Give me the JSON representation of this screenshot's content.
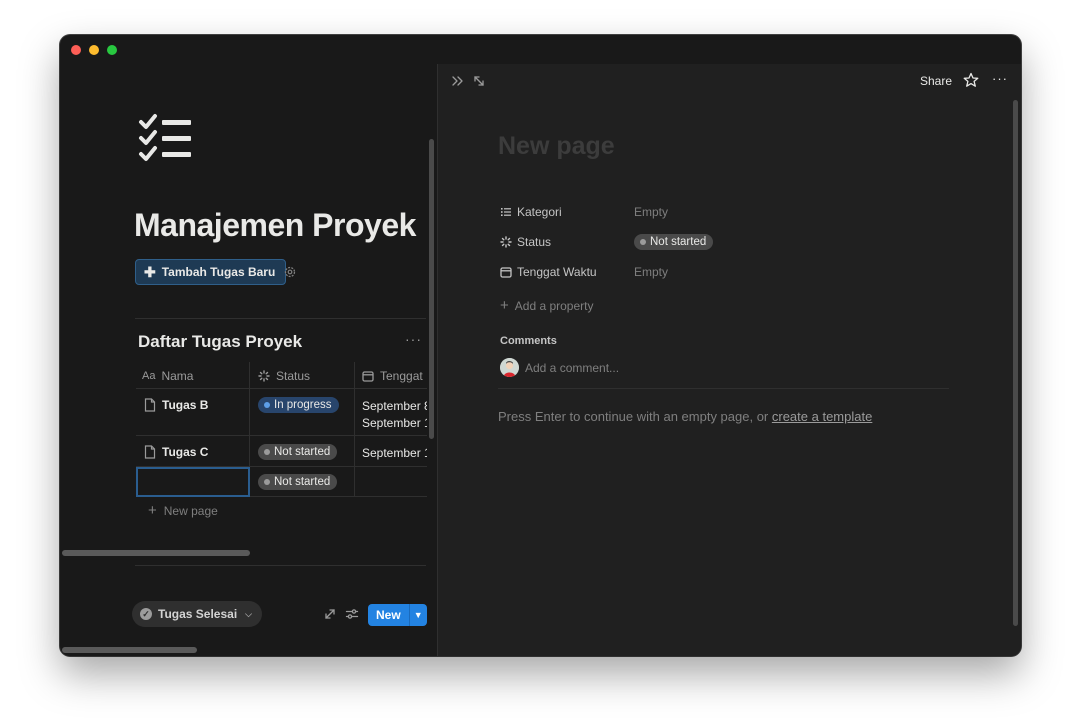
{
  "left": {
    "page_icon": "checklist-icon",
    "title": "Manajemen Proyek",
    "add_task_label": "Tambah Tugas Baru",
    "database_title": "Daftar Tugas Proyek",
    "columns": [
      {
        "label": "Nama",
        "icon": "text-aa-icon"
      },
      {
        "label": "Status",
        "icon": "status-loader-icon"
      },
      {
        "label": "Tenggat",
        "icon": "calendar-icon"
      }
    ],
    "rows": [
      {
        "name": "Tugas B",
        "status": "In progress",
        "date_lines": [
          "September 8",
          "September 1"
        ]
      },
      {
        "name": "Tugas C",
        "status": "Not started",
        "date_lines": [
          "September 1"
        ]
      },
      {
        "name": "",
        "status": "Not started",
        "date_lines": []
      }
    ],
    "new_page_label": "New page",
    "group_chip_label": "Tugas Selesai",
    "new_button_label": "New"
  },
  "peek": {
    "share_label": "Share",
    "title_placeholder": "New page",
    "properties": [
      {
        "label": "Kategori",
        "icon": "list-icon",
        "value": "Empty"
      },
      {
        "label": "Status",
        "icon": "status-loader-icon",
        "value": "Not started"
      },
      {
        "label": "Tenggat Waktu",
        "icon": "calendar-icon",
        "value": "Empty"
      }
    ],
    "add_property_label": "Add a property",
    "comments_label": "Comments",
    "comment_placeholder": "Add a comment...",
    "hint_prefix": "Press Enter to continue with an empty page, or ",
    "hint_link": "create a template"
  },
  "colors": {
    "accent": "#2383e2",
    "in_progress": "#28456c",
    "not_started": "#4a4a4a",
    "background": "#191919"
  }
}
